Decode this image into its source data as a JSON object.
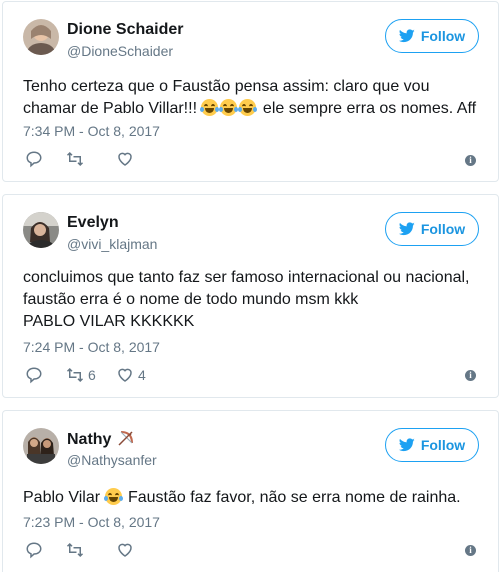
{
  "tweets": [
    {
      "name": "Dione Schaider",
      "handle": "@DioneSchaider",
      "follow_label": "Follow",
      "text_before": "Tenho certeza que o Faustão pensa assim: claro que vou chamar de Pablo Villar!!! ",
      "emoji": "face-with-tears-of-joy",
      "text_after": " ele sempre erra os nomes. Aff",
      "timestamp": "7:34 PM - Oct 8, 2017",
      "retweets": "",
      "likes": ""
    },
    {
      "name": "Evelyn",
      "handle": "@vivi_klajman",
      "follow_label": "Follow",
      "lines": [
        "concluimos que tanto faz ser famoso internacional ou nacional,",
        "faustão erra é o nome de todo mundo msm kkk",
        "PABLO VILAR KKKKKK"
      ],
      "timestamp": "7:24 PM - Oct 8, 2017",
      "retweets": "6",
      "likes": "4"
    },
    {
      "name": "Nathy",
      "name_emoji": "bow-and-arrow",
      "handle": "@Nathysanfer",
      "follow_label": "Follow",
      "text_before": "Pablo Vilar ",
      "emoji": "face-with-tears-of-joy",
      "text_after": " Faustão faz favor, não se erra nome de rainha.",
      "timestamp": "7:23 PM - Oct 8, 2017",
      "retweets": "",
      "likes": ""
    }
  ],
  "icons": {
    "bird": "twitter-bird-icon",
    "reply": "reply-icon",
    "retweet": "retweet-icon",
    "like": "heart-icon",
    "info": "info-icon"
  },
  "colors": {
    "twitter_blue": "#1da1f2",
    "follow_text": "#1b95e0",
    "secondary_text": "#657786",
    "border": "#e1e8ed"
  }
}
